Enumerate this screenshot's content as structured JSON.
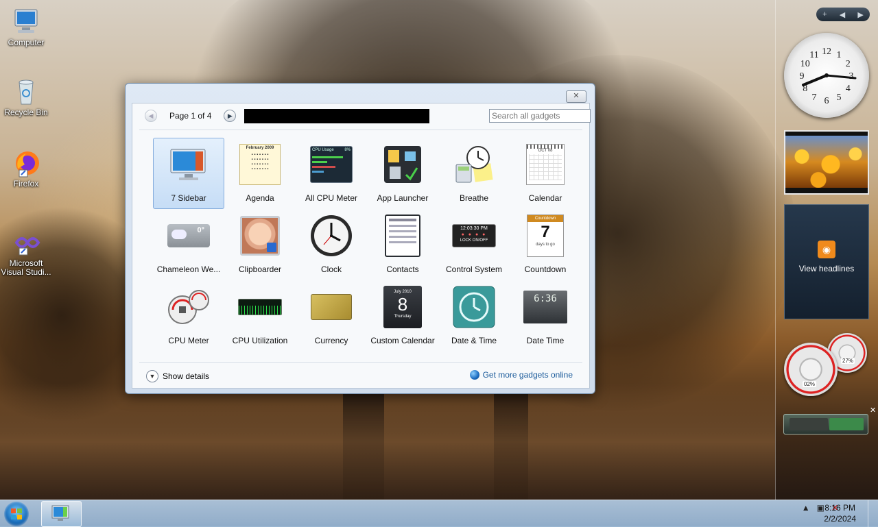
{
  "desktop": {
    "icons": [
      {
        "label": "Computer"
      },
      {
        "label": "Recycle Bin"
      },
      {
        "label": "Firefox"
      },
      {
        "label": "Microsoft Visual Studi..."
      }
    ]
  },
  "gallery": {
    "close_glyph": "✕",
    "page_label": "Page 1 of 4",
    "search_placeholder": "Search all gadgets",
    "gadgets": [
      {
        "name": "7 Sidebar"
      },
      {
        "name": "Agenda"
      },
      {
        "name": "All CPU Meter"
      },
      {
        "name": "App Launcher"
      },
      {
        "name": "Breathe"
      },
      {
        "name": "Calendar"
      },
      {
        "name": "Chameleon We..."
      },
      {
        "name": "Clipboarder"
      },
      {
        "name": "Clock"
      },
      {
        "name": "Contacts"
      },
      {
        "name": "Control System"
      },
      {
        "name": "Countdown"
      },
      {
        "name": "CPU Meter"
      },
      {
        "name": "CPU Utilization"
      },
      {
        "name": "Currency"
      },
      {
        "name": "Custom Calendar"
      },
      {
        "name": "Date & Time"
      },
      {
        "name": "Date Time"
      }
    ],
    "thumb_text": {
      "agenda": "February 2009",
      "cpu_usage": "CPU Usage",
      "cpu_usage_pct": "8%",
      "weather_temp": "0°",
      "calendar_month": "OCT 08",
      "countdown_label": "Countdown",
      "countdown_number": "7",
      "countdown_sub": "days to go",
      "control_time": "12:03:30 PM",
      "control_lock": "LOCK ON/OFF",
      "custom_cal_month": "July 2010",
      "custom_cal_day": "8",
      "custom_cal_weekday": "Thursday",
      "date_time_digits": "6:36"
    },
    "show_details": "Show details",
    "get_more": "Get more gadgets online",
    "selected_index": 0
  },
  "sidebar": {
    "controls": {
      "add": "+",
      "prev": "◀",
      "next": "▶"
    },
    "clock_numbers": [
      "12",
      "1",
      "2",
      "3",
      "4",
      "5",
      "6",
      "7",
      "8",
      "9",
      "10",
      "11"
    ],
    "feed_label": "View headlines",
    "meter_left_value": "02%",
    "meter_right_value": "27%"
  },
  "taskbar": {
    "time": "8:16 PM",
    "date": "2/2/2024"
  },
  "colors": {
    "accent": "#1a5a9a",
    "selection": "#c6ddf6"
  }
}
